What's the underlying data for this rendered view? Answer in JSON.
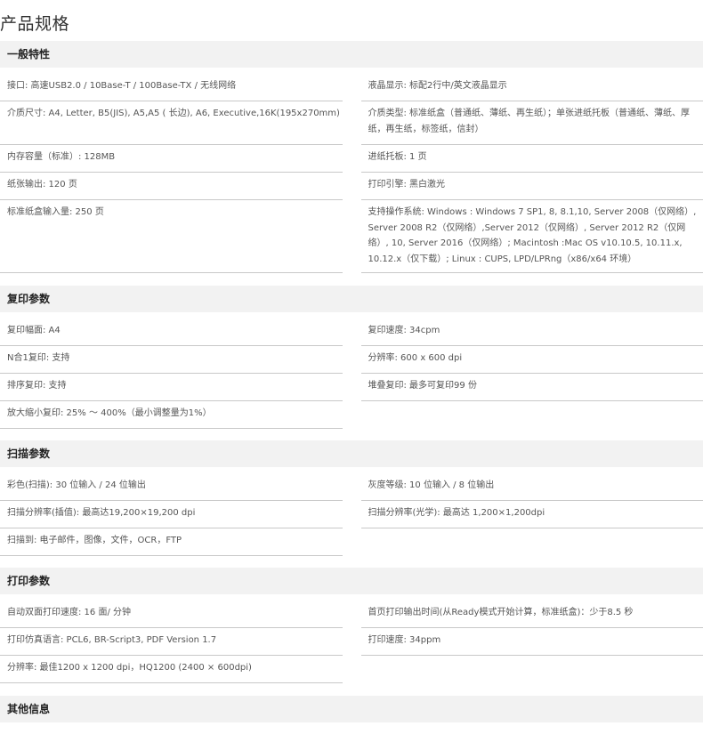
{
  "page_title": "产品规格",
  "sections": [
    {
      "title": "一般特性",
      "left": [
        "接口: 高速USB2.0 / 10Base-T / 100Base-TX / 无线网络",
        "介质尺寸: A4, Letter, B5(JIS), A5,A5 ( 长边), A6, Executive,16K(195x270mm)",
        "内存容量（标准）: 128MB",
        "纸张输出: 120 页",
        "标准纸盒输入量: 250 页"
      ],
      "right": [
        "液晶显示: 标配2行中/英文液晶显示",
        "介质类型: 标准纸盒（普通纸、薄纸、再生纸）；单张进纸托板（普通纸、薄纸、厚纸，再生纸，标签纸，信封）",
        "进纸托板: 1 页",
        "打印引擎: 黑白激光",
        "支持操作系统: Windows : Windows 7 SP1, 8, 8.1,10, Server 2008（仅网络）, Server 2008 R2（仅网络）,Server 2012（仅网络）, Server 2012 R2（仅网络）, 10, Server 2016（仅网络）; Macintosh :Mac OS v10.10.5, 10.11.x, 10.12.x（仅下载）; Linux : CUPS, LPD/LPRng（x86/x64 环境）"
      ]
    },
    {
      "title": "复印参数",
      "left": [
        "复印幅面: A4",
        "N合1复印: 支持",
        "排序复印: 支持",
        "放大缩小复印: 25% ～ 400%（最小调整量为1%）"
      ],
      "right": [
        "复印速度: 34cpm",
        "分辨率: 600 x 600 dpi",
        "堆叠复印: 最多可复印99 份"
      ]
    },
    {
      "title": "扫描参数",
      "left": [
        "彩色(扫描): 30 位输入 /  24 位输出",
        "扫描分辨率(插值): 最高达19,200×19,200 dpi",
        "扫描到: 电子邮件，图像，文件，OCR，FTP"
      ],
      "right": [
        "灰度等级: 10 位输入 /  8 位输出",
        "扫描分辨率(光学): 最高达 1,200×1,200dpi"
      ]
    },
    {
      "title": "打印参数",
      "left": [
        "自动双面打印速度: 16 面/ 分钟",
        "打印仿真语言: PCL6, BR-Script3, PDF Version 1.7",
        "分辨率: 最佳1200 x 1200 dpi，HQ1200 (2400 × 600dpi)"
      ],
      "right": [
        "首页打印输出时间(从Ready模式开始计算，标准纸盒)：少于8.5 秒",
        "打印速度: 34ppm"
      ]
    },
    {
      "title": "其他信息",
      "left": [],
      "right": []
    }
  ]
}
